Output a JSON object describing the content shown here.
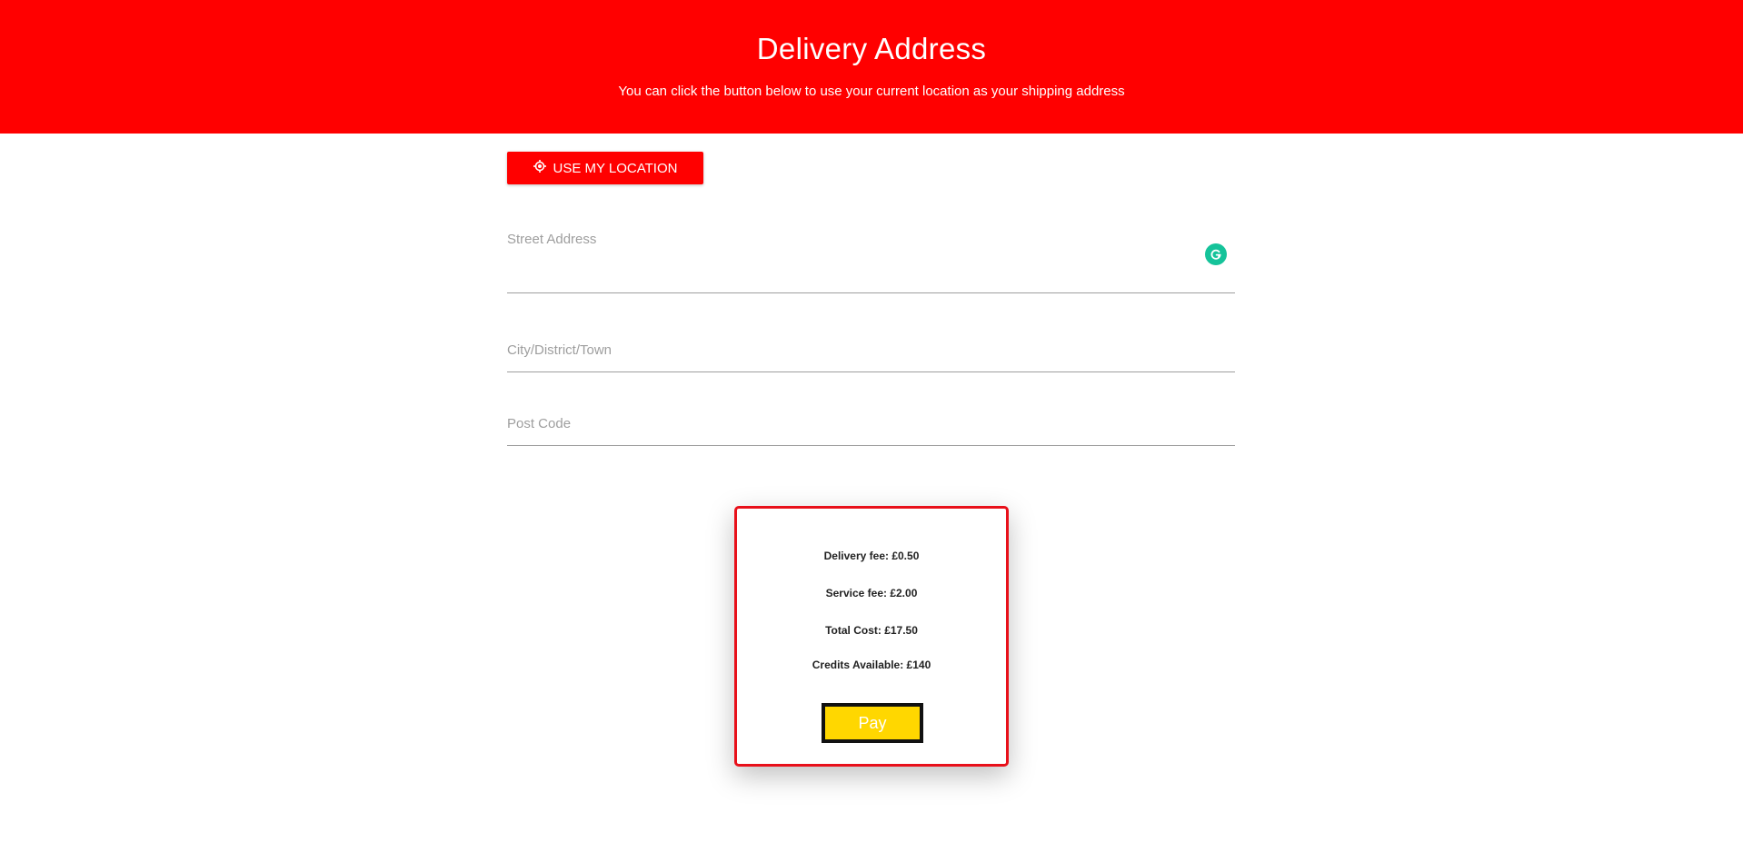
{
  "header": {
    "title": "Delivery Address",
    "subtitle": "You can click the button below to use your current location as your shipping address"
  },
  "location_button": {
    "label": "USE MY LOCATION",
    "icon": "location-target-icon"
  },
  "form": {
    "street": {
      "placeholder": "Street Address",
      "value": ""
    },
    "city": {
      "placeholder": "City/District/Town",
      "value": ""
    },
    "postcode": {
      "placeholder": "Post Code",
      "value": ""
    }
  },
  "summary": {
    "delivery_fee": "Delivery fee: £0.50",
    "service_fee": "Service fee: £2.00",
    "total_cost": "Total Cost: £17.50",
    "credits": "Credits Available: £140",
    "pay_label": "Pay"
  },
  "colors": {
    "brand_red": "#ff0000",
    "card_border": "#e8101a",
    "pay_yellow": "#ffd700",
    "grammarly_green": "#15c39a"
  }
}
